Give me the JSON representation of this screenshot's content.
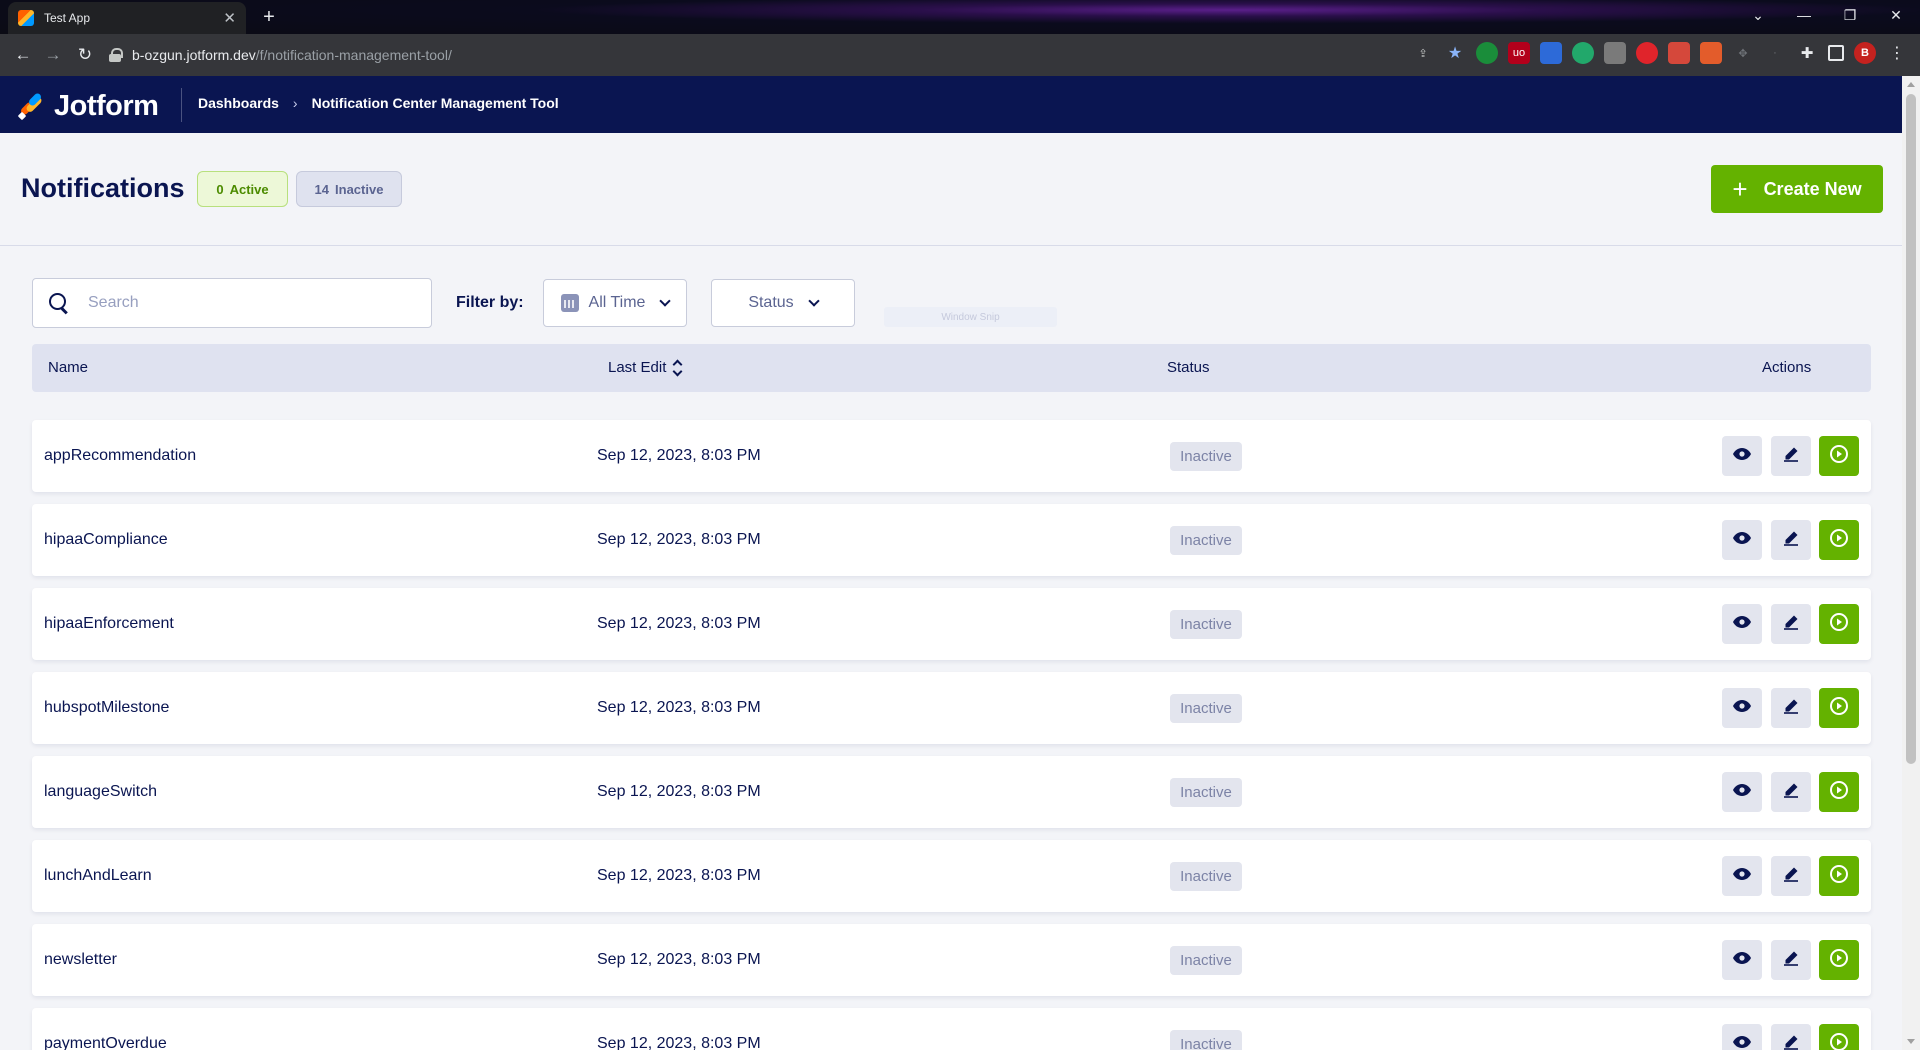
{
  "browser": {
    "tab_title": "Test App",
    "url_host": "b-ozgun.jotform.dev",
    "url_path": "/f/notification-management-tool/",
    "profile_initial": "B"
  },
  "app": {
    "logo_text": "Jotform",
    "breadcrumb": [
      "Dashboards",
      "Notification Center Management Tool"
    ]
  },
  "page": {
    "title": "Notifications",
    "active_count": "0",
    "active_label": "Active",
    "inactive_count": "14",
    "inactive_label": "Inactive",
    "create_label": "Create New"
  },
  "filters": {
    "search_placeholder": "Search",
    "filter_label": "Filter by:",
    "time_value": "All Time",
    "status_value": "Status",
    "overlay_text": "Window Snip"
  },
  "table": {
    "columns": [
      "Name",
      "Last Edit",
      "Status",
      "Actions"
    ],
    "rows": [
      {
        "name": "appRecommendation",
        "last_edit": "Sep 12, 2023, 8:03 PM",
        "status": "Inactive"
      },
      {
        "name": "hipaaCompliance",
        "last_edit": "Sep 12, 2023, 8:03 PM",
        "status": "Inactive"
      },
      {
        "name": "hipaaEnforcement",
        "last_edit": "Sep 12, 2023, 8:03 PM",
        "status": "Inactive"
      },
      {
        "name": "hubspotMilestone",
        "last_edit": "Sep 12, 2023, 8:03 PM",
        "status": "Inactive"
      },
      {
        "name": "languageSwitch",
        "last_edit": "Sep 12, 2023, 8:03 PM",
        "status": "Inactive"
      },
      {
        "name": "lunchAndLearn",
        "last_edit": "Sep 12, 2023, 8:03 PM",
        "status": "Inactive"
      },
      {
        "name": "newsletter",
        "last_edit": "Sep 12, 2023, 8:03 PM",
        "status": "Inactive"
      },
      {
        "name": "paymentOverdue",
        "last_edit": "Sep 12, 2023, 8:03 PM",
        "status": "Inactive"
      }
    ]
  },
  "colors": {
    "header_bg": "#0a1551",
    "accent_green": "#64b200",
    "page_bg": "#f3f4f8"
  }
}
